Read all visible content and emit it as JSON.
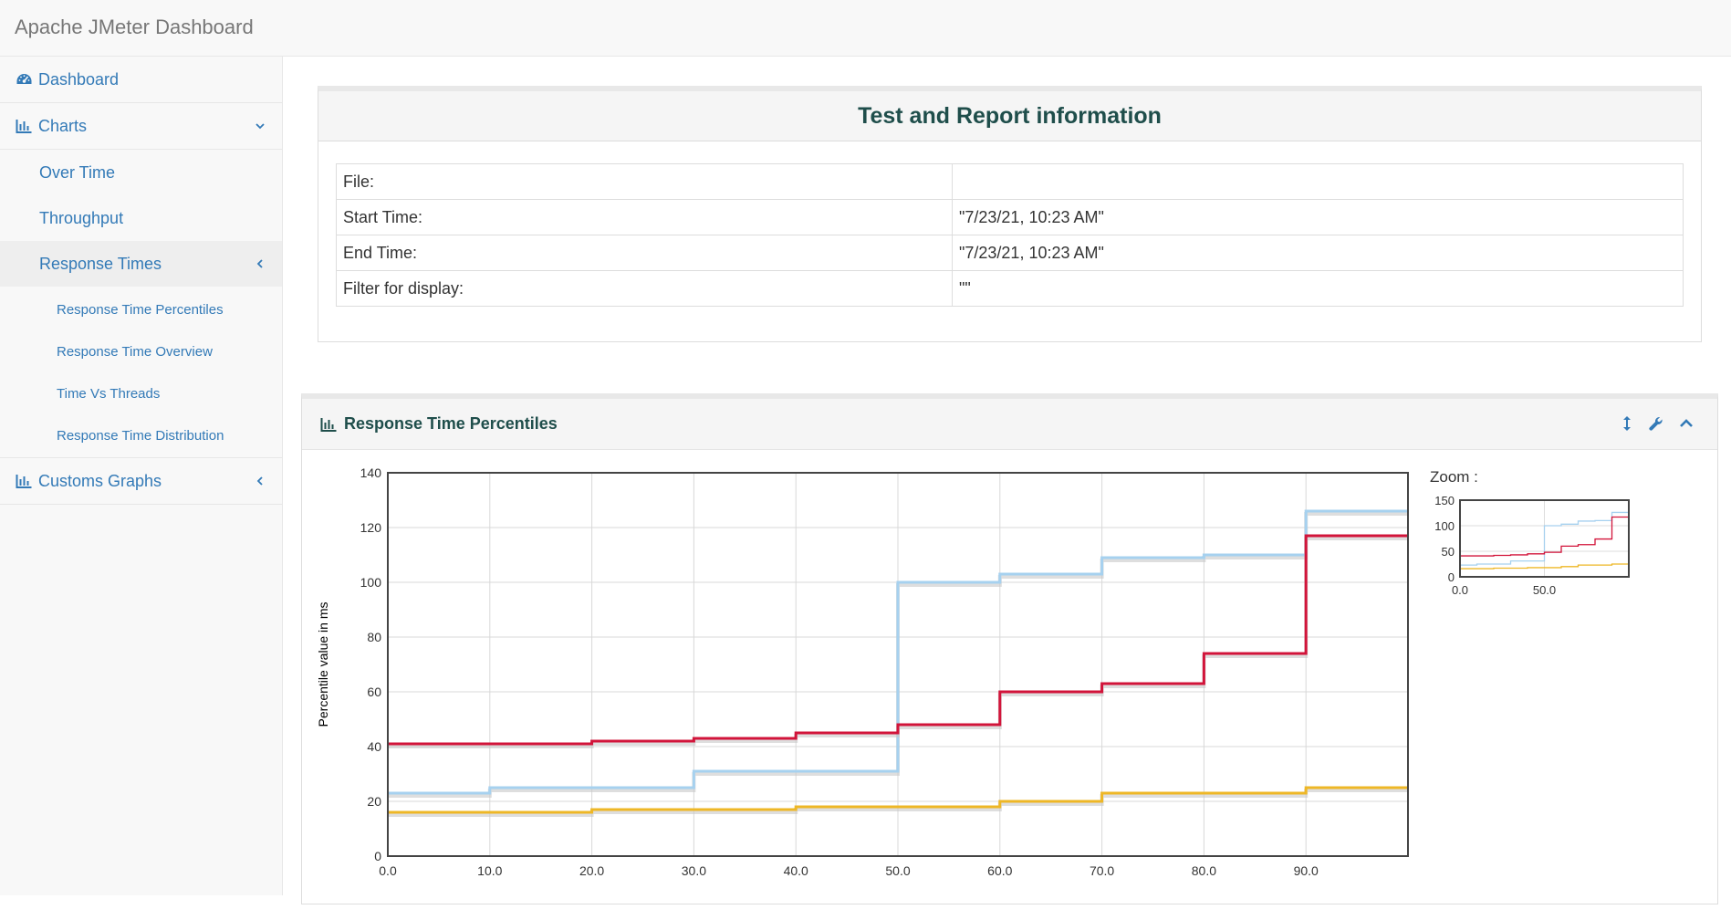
{
  "app": {
    "title": "Apache JMeter Dashboard"
  },
  "sidebar": {
    "dashboard": "Dashboard",
    "charts": "Charts",
    "over_time": "Over Time",
    "throughput": "Throughput",
    "response_times": "Response Times",
    "rt_items": [
      "Response Time Percentiles",
      "Response Time Overview",
      "Time Vs Threads",
      "Response Time Distribution"
    ],
    "customs_graphs": "Customs Graphs"
  },
  "icons": {
    "dashboard": "dashboard-gauge-icon",
    "charts": "bar-chart-icon",
    "customs": "bar-chart-icon",
    "expand": "chevron-down-icon",
    "collapse": "chevron-left-icon",
    "tools": [
      "resize-vertical-icon",
      "wrench-icon",
      "chevron-up-icon"
    ]
  },
  "colors": {
    "link": "#337ab7",
    "heading": "#1f4e4b"
  },
  "info": {
    "title": "Test and Report information",
    "rows": [
      {
        "label": "File:",
        "value": ""
      },
      {
        "label": "Start Time:",
        "value": "\"7/23/21, 10:23 AM\""
      },
      {
        "label": "End Time:",
        "value": "\"7/23/21, 10:23 AM\""
      },
      {
        "label": "Filter for display:",
        "value": "\"\""
      }
    ]
  },
  "chart_panel": {
    "title": "Response Time Percentiles"
  },
  "chart_data": {
    "type": "line",
    "title": "Response Time Percentiles",
    "xlabel": "",
    "ylabel": "Percentile value in ms",
    "xlim": [
      0,
      100
    ],
    "ylim": [
      0,
      140
    ],
    "xticks": [
      "0.0",
      "10.0",
      "20.0",
      "30.0",
      "40.0",
      "50.0",
      "60.0",
      "70.0",
      "80.0",
      "90.0"
    ],
    "yticks": [
      "0",
      "20",
      "40",
      "60",
      "80",
      "100",
      "120",
      "140"
    ],
    "grid": true,
    "step": true,
    "x": [
      0,
      10,
      20,
      30,
      40,
      50,
      60,
      70,
      80,
      90,
      100
    ],
    "series": [
      {
        "color": "#d2143a",
        "values": [
          41,
          41,
          42,
          43,
          45,
          48,
          60,
          63,
          74,
          117,
          117
        ]
      },
      {
        "color": "#a6d1ef",
        "values": [
          23,
          25,
          25,
          31,
          31,
          100,
          103,
          109,
          110,
          126,
          126
        ]
      },
      {
        "color": "#eeb726",
        "values": [
          16,
          16,
          17,
          17,
          18,
          18,
          20,
          23,
          23,
          25,
          25
        ]
      }
    ],
    "zoom": {
      "label": "Zoom :",
      "ylim": [
        0,
        150
      ],
      "yticks": [
        "0",
        "50",
        "100",
        "150"
      ],
      "xticks": [
        "0.0",
        "50.0"
      ]
    }
  }
}
